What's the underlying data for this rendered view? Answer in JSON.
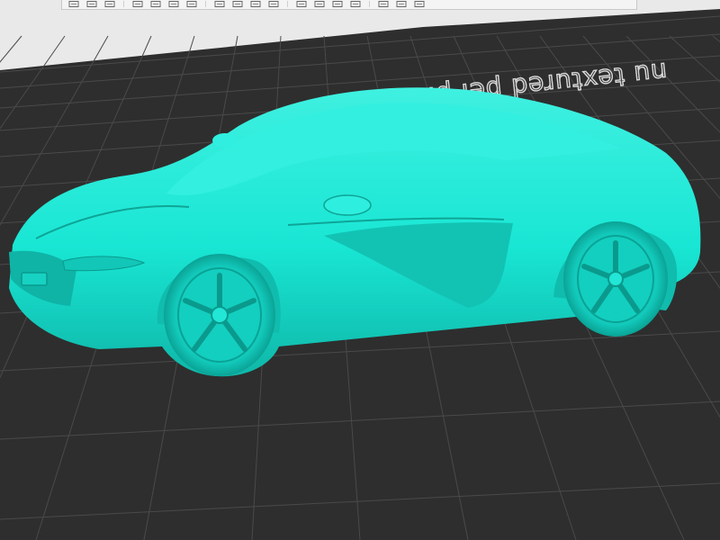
{
  "viewport": {
    "background_color": "#2b2b2b",
    "bed_color": "#2e2e2e",
    "grid_color": "#4a4a4a",
    "sky_color": "#e9e9e9",
    "bed_label": "nu textured pei pla",
    "model_color": "#19e6d4"
  },
  "toolbar": {
    "tools": [
      {
        "name": "add-model-icon"
      },
      {
        "name": "add-plate-icon"
      },
      {
        "name": "auto-orient-icon"
      },
      {
        "name": "arrange-icon"
      },
      {
        "name": "split-objects-icon"
      },
      {
        "name": "split-parts-icon"
      },
      {
        "name": "layer-editing-icon"
      },
      {
        "name": "move-icon"
      },
      {
        "name": "rotate-icon"
      },
      {
        "name": "scale-icon"
      },
      {
        "name": "lay-on-face-icon"
      },
      {
        "name": "cut-icon"
      },
      {
        "name": "support-paint-icon"
      },
      {
        "name": "seam-paint-icon"
      },
      {
        "name": "color-paint-icon"
      },
      {
        "name": "measure-icon"
      },
      {
        "name": "assemble-icon"
      },
      {
        "name": "text-icon"
      }
    ]
  }
}
